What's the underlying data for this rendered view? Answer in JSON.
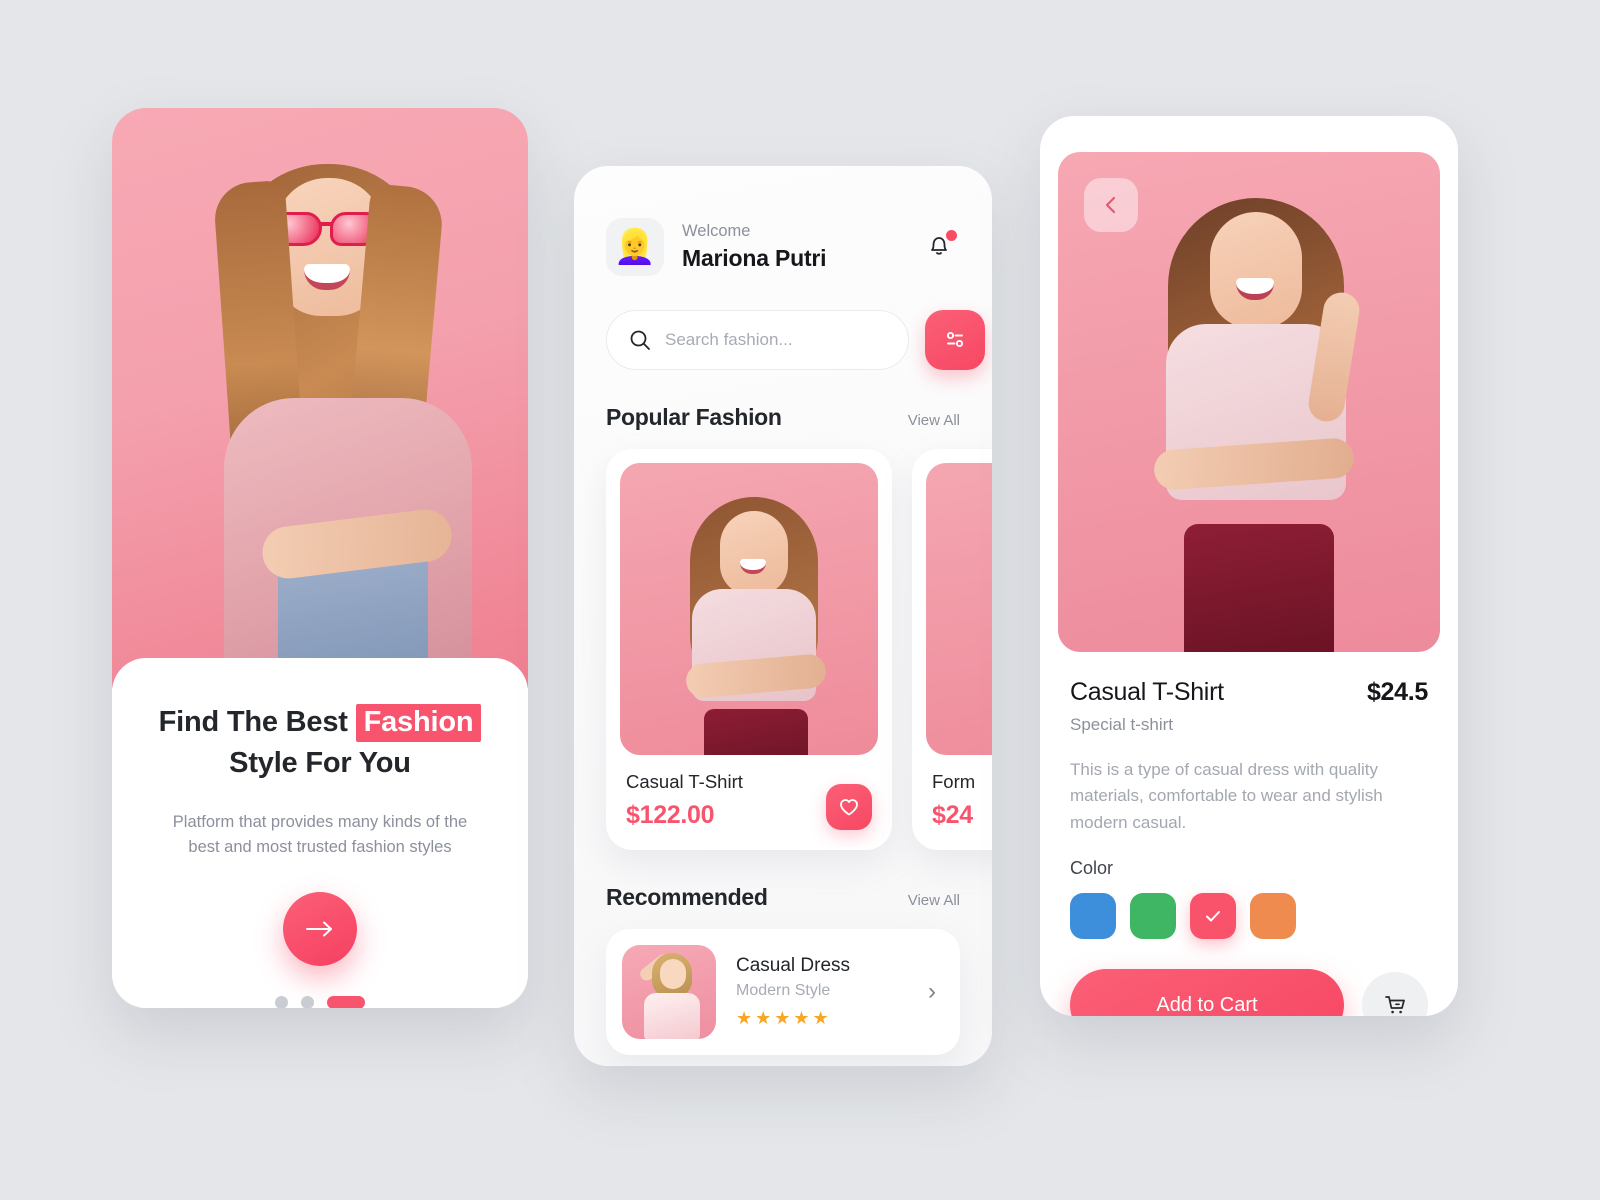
{
  "background_color": "#e4e6e9",
  "accent_color": "#f9546e",
  "onboarding": {
    "title_part1": "Find The Best",
    "title_highlight": "Fashion",
    "title_part2": "Style For You",
    "subtitle": "Platform that provides many kinds of the best and most trusted fashion styles",
    "cta_icon": "arrow-right-icon",
    "pagination": {
      "total": 3,
      "active_index": 2
    }
  },
  "home": {
    "header": {
      "avatar_emoji": "👱‍♀️",
      "welcome_label": "Welcome",
      "user_name": "Mariona Putri",
      "bell_icon": "notification-bell-icon",
      "has_notification": true
    },
    "search": {
      "placeholder": "Search fashion...",
      "value": "",
      "icon": "search-icon",
      "filter_icon": "filter-icon"
    },
    "popular": {
      "title": "Popular Fashion",
      "view_all": "View All",
      "items": [
        {
          "name": "Casual T-Shirt",
          "price": "$122.00",
          "fav_icon": "heart-icon"
        },
        {
          "name": "Form",
          "price": "$24"
        }
      ]
    },
    "recommended": {
      "title": "Recommended",
      "view_all": "View All",
      "items": [
        {
          "name": "Casual Dress",
          "style": "Modern Style",
          "stars": "★★★★★",
          "rating": 5,
          "chevron": "›"
        }
      ]
    }
  },
  "detail": {
    "back_icon": "chevron-left-icon",
    "product_name": "Casual T-Shirt",
    "product_subtitle": "Special t-shirt",
    "price": "$24.5",
    "description": "This is a type of casual dress with quality materials, comfortable to wear and stylish modern casual.",
    "color_label": "Color",
    "colors": [
      {
        "name": "blue",
        "hex": "#3d8fdb",
        "selected": false
      },
      {
        "name": "green",
        "hex": "#3fb663",
        "selected": false
      },
      {
        "name": "pink",
        "hex": "#f9536b",
        "selected": true
      },
      {
        "name": "orange",
        "hex": "#f08b4f",
        "selected": false
      }
    ],
    "add_to_cart_label": "Add to Cart",
    "cart_icon": "shopping-cart-icon"
  }
}
